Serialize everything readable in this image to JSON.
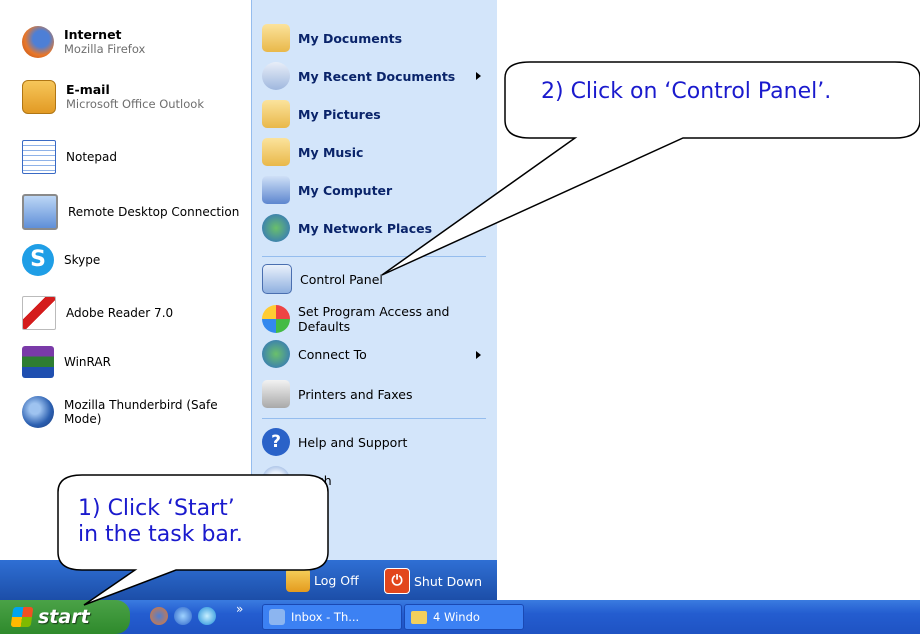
{
  "left_items": [
    {
      "main": "Internet",
      "sub": "Mozilla Firefox",
      "icon": "firefox-icon"
    },
    {
      "main": "E-mail",
      "sub": "Microsoft Office Outlook",
      "icon": "outlook-icon"
    },
    {
      "main": "Notepad",
      "sub": "",
      "icon": "notepad-icon"
    },
    {
      "main": "Remote Desktop Connection",
      "sub": "",
      "icon": "remote-desktop-icon"
    },
    {
      "main": "Skype",
      "sub": "",
      "icon": "skype-icon"
    },
    {
      "main": "Adobe Reader 7.0",
      "sub": "",
      "icon": "adobe-reader-icon"
    },
    {
      "main": "WinRAR",
      "sub": "",
      "icon": "winrar-icon"
    },
    {
      "main": "Mozilla Thunderbird (Safe Mode)",
      "sub": "",
      "icon": "thunderbird-icon"
    }
  ],
  "right_items": [
    {
      "label": "My Documents",
      "icon": "my-documents-icon"
    },
    {
      "label": "My Recent Documents",
      "icon": "recent-documents-icon"
    },
    {
      "label": "My Pictures",
      "icon": "my-pictures-icon"
    },
    {
      "label": "My Music",
      "icon": "my-music-icon"
    },
    {
      "label": "My Computer",
      "icon": "my-computer-icon"
    },
    {
      "label": "My Network Places",
      "icon": "network-places-icon"
    },
    {
      "label": "Control Panel",
      "icon": "control-panel-icon"
    },
    {
      "label": "Set Program Access and Defaults",
      "icon": "program-access-icon"
    },
    {
      "label": "Connect To",
      "icon": "connect-to-icon"
    },
    {
      "label": "Printers and Faxes",
      "icon": "printers-icon"
    },
    {
      "label": "Help and Support",
      "icon": "help-icon"
    },
    {
      "label": "rch",
      "icon": "search-icon"
    },
    {
      "label": "...",
      "icon": "run-icon"
    }
  ],
  "bottom_bar": {
    "log_off": "Log Off",
    "shut_down": "Shut Down"
  },
  "taskbar": {
    "start_label": "start",
    "overflow": "»",
    "tasks": [
      "Inbox - Th...",
      "4 Windo"
    ]
  },
  "callouts": {
    "start_line1": "1) Click ‘Start’",
    "start_line2": "in the task bar.",
    "control_panel": "2) Click on ‘Control Panel’."
  },
  "colors": {
    "right_panel": "#d3e5fa",
    "taskbar": "#245dd0",
    "start": "#3a963a",
    "callout_text": "#1a1acd"
  }
}
